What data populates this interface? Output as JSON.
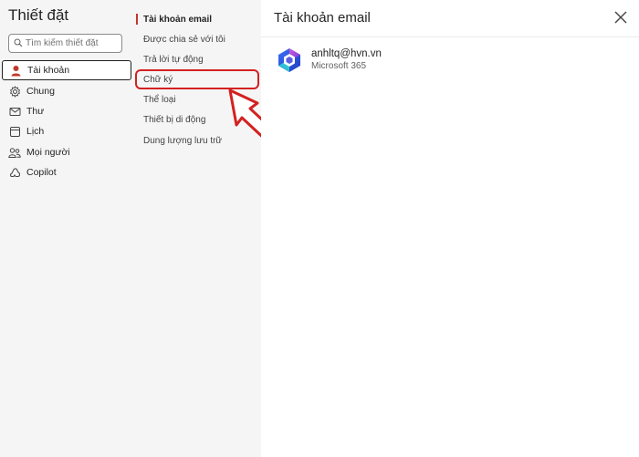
{
  "settings": {
    "title": "Thiết đặt",
    "search_placeholder": "Tìm kiếm thiết đặt"
  },
  "nav": {
    "items": [
      {
        "label": "Tài khoản",
        "icon": "person-icon",
        "active": true
      },
      {
        "label": "Chung",
        "icon": "gear-icon"
      },
      {
        "label": "Thư",
        "icon": "mail-icon"
      },
      {
        "label": "Lịch",
        "icon": "calendar-icon"
      },
      {
        "label": "Mọi người",
        "icon": "people-icon"
      },
      {
        "label": "Copilot",
        "icon": "copilot-icon"
      }
    ]
  },
  "subnav": {
    "items": [
      {
        "label": "Tài khoản email",
        "active": true
      },
      {
        "label": "Được chia sẻ với tôi"
      },
      {
        "label": "Trả lời tự động"
      },
      {
        "label": "Chữ ký",
        "highlighted": true
      },
      {
        "label": "Thể loại"
      },
      {
        "label": "Thiết bị di động"
      },
      {
        "label": "Dung lượng lưu trữ"
      }
    ]
  },
  "main": {
    "title": "Tài khoản email",
    "account": {
      "email": "anhltq@hvn.vn",
      "product": "Microsoft 365"
    }
  },
  "colors": {
    "accent_red": "#d32121",
    "active_bar": "#c0392b",
    "panel_bg": "#f5f5f5"
  }
}
